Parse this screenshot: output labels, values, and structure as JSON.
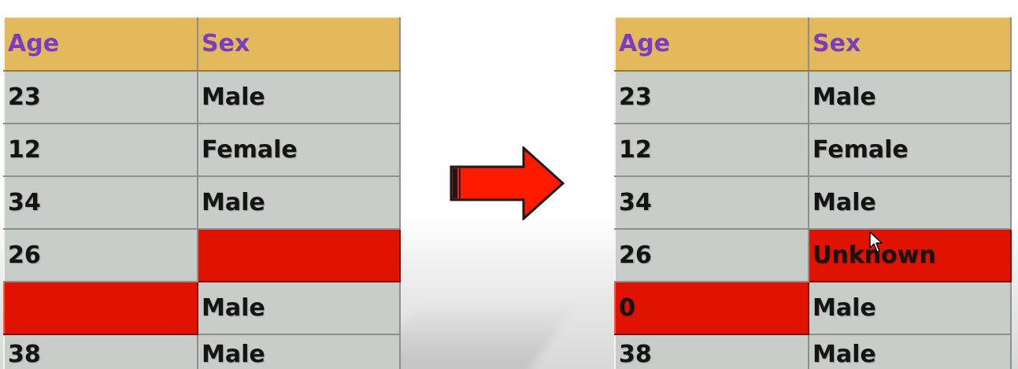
{
  "tables": {
    "before": {
      "headers": [
        "Age",
        "Sex"
      ],
      "rows": [
        {
          "age": "23",
          "sex": "Male"
        },
        {
          "age": "12",
          "sex": "Female"
        },
        {
          "age": "34",
          "sex": "Male"
        },
        {
          "age": "26",
          "sex": ""
        },
        {
          "age": "",
          "sex": "Male"
        },
        {
          "age": "38",
          "sex": "Male"
        }
      ]
    },
    "after": {
      "headers": [
        "Age",
        "Sex"
      ],
      "rows": [
        {
          "age": "23",
          "sex": "Male"
        },
        {
          "age": "12",
          "sex": "Female"
        },
        {
          "age": "34",
          "sex": "Male"
        },
        {
          "age": "26",
          "sex": "Unknown"
        },
        {
          "age": "0",
          "sex": "Male"
        },
        {
          "age": "38",
          "sex": "Male"
        }
      ]
    }
  },
  "arrow": {
    "icon": "right-arrow-icon",
    "color": "#ff1a00"
  },
  "colors": {
    "header_bg": "#e3b95c",
    "header_text": "#7a3cc0",
    "cell_bg": "#c9cdca",
    "missing_bg": "#e01200"
  },
  "cursor": {
    "icon": "mouse-pointer-icon"
  }
}
